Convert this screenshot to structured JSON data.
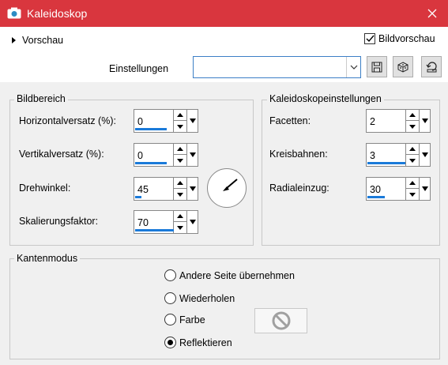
{
  "window": {
    "title": "Kaleidoskop",
    "close_icon": "close-icon",
    "app_icon": "camera-icon"
  },
  "preview": {
    "label": "Vorschau",
    "bildvorschau_label": "Bildvorschau",
    "bildvorschau_checked": true
  },
  "einstellungen": {
    "label": "Einstellungen",
    "value": ""
  },
  "toolbar_icons": [
    "save-icon",
    "randomize-dice-icon",
    "reset-icon"
  ],
  "bildbereich": {
    "title": "Bildbereich",
    "fields": [
      {
        "label": "Horizontalversatz (%):",
        "value": "0"
      },
      {
        "label": "Vertikalversatz (%):",
        "value": "0"
      },
      {
        "label": "Drehwinkel:",
        "value": "45"
      },
      {
        "label": "Skalierungsfaktor:",
        "value": "70"
      }
    ]
  },
  "kaleido": {
    "title": "Kaleidoskopeinstellungen",
    "fields": [
      {
        "label": "Facetten:",
        "value": "2"
      },
      {
        "label": "Kreisbahnen:",
        "value": "3"
      },
      {
        "label": "Radialeinzug:",
        "value": "30"
      }
    ]
  },
  "kantenmodus": {
    "title": "Kantenmodus",
    "options": [
      {
        "label": "Andere Seite übernehmen",
        "selected": false
      },
      {
        "label": "Wiederholen",
        "selected": false
      },
      {
        "label": "Farbe",
        "selected": false
      },
      {
        "label": "Reflektieren",
        "selected": true
      }
    ],
    "color_swatch_icon": "no-color-icon"
  },
  "colors": {
    "titlebar": "#d9363e",
    "accent": "#1a7ad9"
  }
}
